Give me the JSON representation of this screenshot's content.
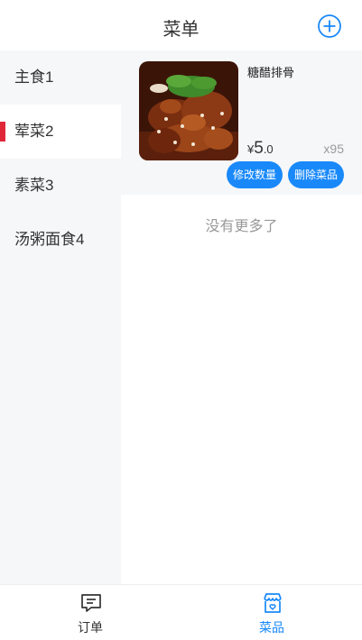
{
  "header": {
    "title": "菜单",
    "add_icon": "plus-circle-icon"
  },
  "sidebar": {
    "items": [
      {
        "label": "主食1",
        "active": false
      },
      {
        "label": "荤菜2",
        "active": true
      },
      {
        "label": "素菜3",
        "active": false
      },
      {
        "label": "汤粥面食4",
        "active": false
      }
    ],
    "active_indicator_color": "#e0273a"
  },
  "dish": {
    "name": "糖醋排骨",
    "price_symbol": "¥",
    "price_int": "5",
    "price_dec": ".0",
    "quantity": "x95",
    "edit_label": "修改数量",
    "delete_label": "删除菜品"
  },
  "list": {
    "no_more": "没有更多了"
  },
  "tabbar": {
    "orders_label": "订单",
    "orders_icon": "message-icon",
    "dishes_label": "菜品",
    "dishes_icon": "shop-icon"
  },
  "colors": {
    "accent": "#1989fa",
    "sidebar_bg": "#f6f7f9"
  }
}
